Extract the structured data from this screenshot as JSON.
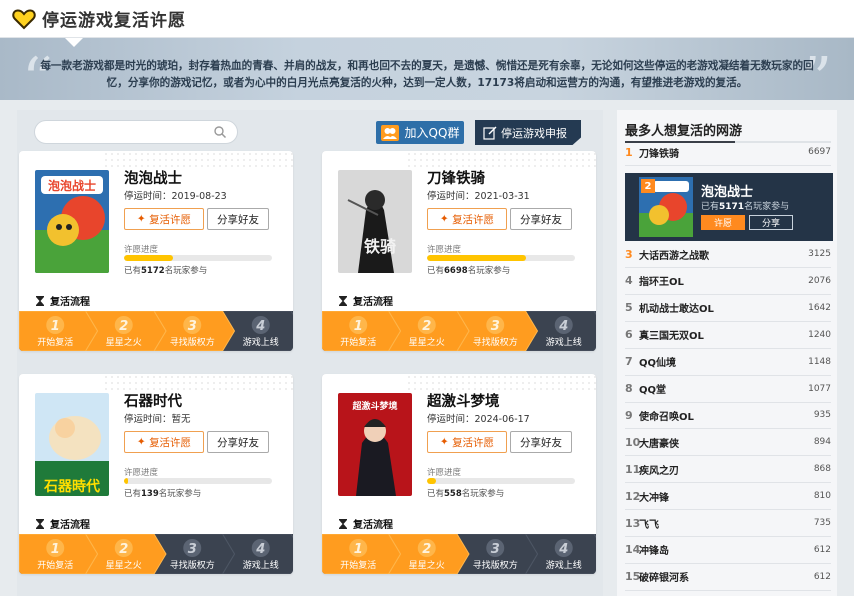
{
  "page": {
    "title": "停运游戏复活许愿",
    "intro": "每一款老游戏都是时光的琥珀，封存着热血的青春、并肩的战友，和再也回不去的夏天，是遗憾、惋惜还是死有余辜，无论如何这些停运的老游戏凝结着无数玩家的回忆，分享你的游戏记忆，或者为心中的白月光点亮复活的火种，达到一定人数，17173将启动和运营方的沟通，有望推进老游戏的复活。"
  },
  "toolbar": {
    "search_placeholder": "",
    "join_label": "加入QQ群",
    "report_label": "停运游戏申报"
  },
  "colors": {
    "accent": "#ff8a1f",
    "progress": "#ffc400",
    "step_active": "#ff9c1f",
    "step_inactive": "#3b4350",
    "dark_panel": "#243447"
  },
  "labels": {
    "wish": "复活许愿",
    "share": "分享好友",
    "progress": "许愿进度",
    "count_prefix": "已有",
    "count_suffix": "名玩家参与",
    "flow": "复活流程"
  },
  "steps": [
    "开始复活",
    "星星之火",
    "寻找版权方",
    "游戏上线"
  ],
  "games": [
    {
      "name": "泡泡战士",
      "date": "停运时间：2019-08-23",
      "count": "5172",
      "progress": 0.33,
      "active_steps": 3,
      "cover": "paopao"
    },
    {
      "name": "刀锋铁骑",
      "date": "停运时间：2021-03-31",
      "count": "6698",
      "progress": 0.67,
      "active_steps": 3,
      "cover": "daofeng"
    },
    {
      "name": "石器时代",
      "date": "停运时间：暂无",
      "count": "139",
      "progress": 0.03,
      "active_steps": 2,
      "cover": "shiqi"
    },
    {
      "name": "超激斗梦境",
      "date": "停运时间：2024-06-17",
      "count": "558",
      "progress": 0.06,
      "active_steps": 2,
      "cover": "chaoji"
    }
  ],
  "sidebar": {
    "title": "最多人想复活的网游",
    "featured": {
      "rank": "2",
      "name": "泡泡战士",
      "count_prefix": "已有",
      "count": "5171",
      "count_suffix": "名玩家参与",
      "wish": "许愿",
      "share": "分享"
    },
    "ranks": [
      {
        "num": "1",
        "name": "刀锋铁骑",
        "count": "6697"
      },
      {
        "num": "3",
        "name": "大话西游之战歌",
        "count": "3125"
      },
      {
        "num": "4",
        "name": "指环王OL",
        "count": "2076"
      },
      {
        "num": "5",
        "name": "机动战士敢达OL",
        "count": "1642"
      },
      {
        "num": "6",
        "name": "真三国无双OL",
        "count": "1240"
      },
      {
        "num": "7",
        "name": "QQ仙境",
        "count": "1148"
      },
      {
        "num": "8",
        "name": "QQ堂",
        "count": "1077"
      },
      {
        "num": "9",
        "name": "使命召唤OL",
        "count": "935"
      },
      {
        "num": "10",
        "name": "大唐豪侠",
        "count": "894"
      },
      {
        "num": "11",
        "name": "疾风之刃",
        "count": "868"
      },
      {
        "num": "12",
        "name": "大冲锋",
        "count": "810"
      },
      {
        "num": "13",
        "name": "飞飞",
        "count": "735"
      },
      {
        "num": "14",
        "name": "冲锋岛",
        "count": "612"
      },
      {
        "num": "15",
        "name": "破碎银河系",
        "count": "612"
      }
    ]
  }
}
